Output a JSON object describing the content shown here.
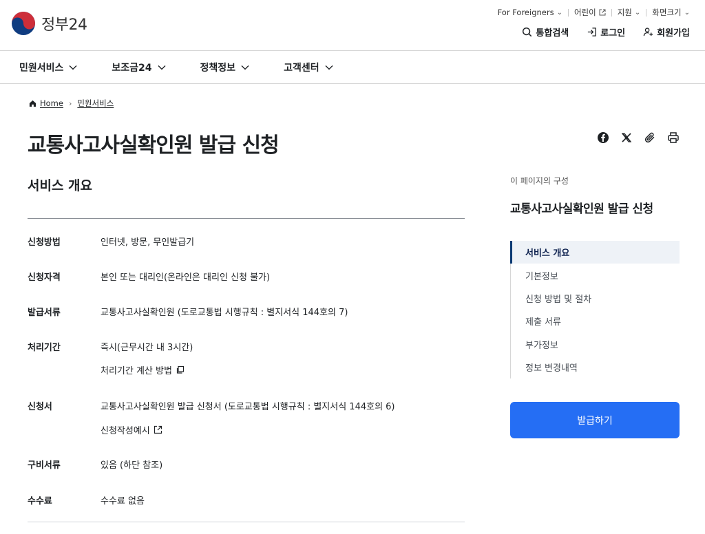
{
  "header": {
    "logo_text": "정부24",
    "util_links": [
      {
        "label": "For Foreigners",
        "icon": "chevron-down-icon"
      },
      {
        "label": "어린이",
        "icon": "external-link-icon"
      },
      {
        "label": "지원",
        "icon": "chevron-down-icon"
      },
      {
        "label": "화면크기",
        "icon": "chevron-down-icon"
      }
    ],
    "user_links": {
      "search": "통합검색",
      "login": "로그인",
      "signup": "회원가입"
    }
  },
  "gnb": [
    {
      "label": "민원서비스"
    },
    {
      "label": "보조금24"
    },
    {
      "label": "정책정보"
    },
    {
      "label": "고객센터"
    }
  ],
  "breadcrumb": {
    "home": "Home",
    "current": "민원서비스"
  },
  "page_title": "교통사고사실확인원 발급 신청",
  "main": {
    "section_title": "서비스 개요",
    "rows": [
      {
        "label": "신청방법",
        "value": "인터넷, 방문, 무인발급기"
      },
      {
        "label": "신청자격",
        "value": "본인 또는 대리인(온라인은 대리인 신청 불가)"
      },
      {
        "label": "발급서류",
        "value": "교통사고사실확인원 (도로교통법 시행규칙 : 별지서식 144호의 7)"
      },
      {
        "label": "처리기간",
        "value": "즉시(근무시간 내 3시간)",
        "sub": "처리기간 계산 방법"
      },
      {
        "label": "신청서",
        "value": "교통사고사실확인원 발급 신청서 (도로교통법 시행규칙 : 별지서식 144호의 6)",
        "sub": "신청작성예시"
      },
      {
        "label": "구비서류",
        "value": "있음 (하단 참조)"
      },
      {
        "label": "수수료",
        "value": "수수료 없음"
      }
    ]
  },
  "toc": {
    "caption": "이 페이지의 구성",
    "title": "교통사고사실확인원 발급 신청",
    "items": [
      {
        "label": "서비스 개요"
      },
      {
        "label": "기본정보"
      },
      {
        "label": "신청 방법 및 절차"
      },
      {
        "label": "제출 서류"
      },
      {
        "label": "부가정보"
      },
      {
        "label": "정보 변경내역"
      }
    ]
  },
  "issue_button": "발급하기",
  "colors": {
    "primary": "#256ef4",
    "toc_active_bar": "#0b3a73",
    "toc_active_bg": "#eef2f7",
    "logo_red": "#cd2e3a",
    "logo_blue": "#0f3c80"
  }
}
